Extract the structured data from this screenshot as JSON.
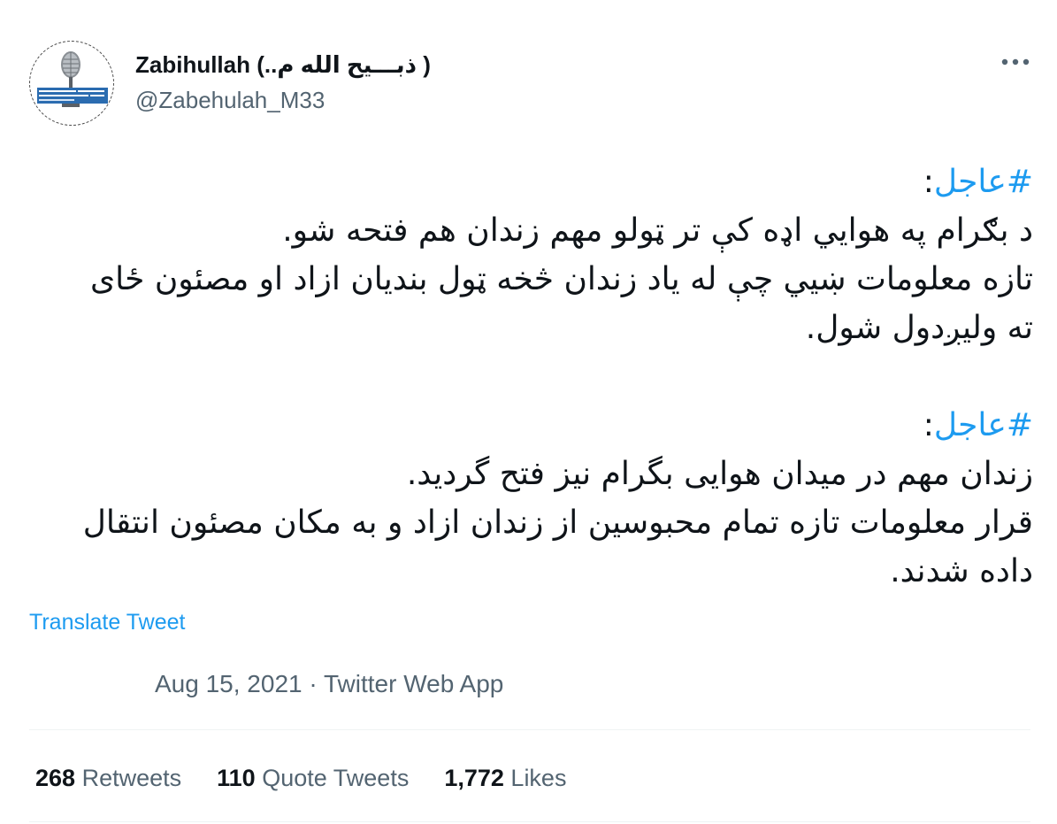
{
  "author": {
    "name": "Zabihullah (..ذبـــیح الله م )",
    "handle": "@Zabehulah_M33",
    "avatar_banner_lines": [
      "د افغانستان اسلامي امارت",
      "امارت اسلامی افغانستان"
    ]
  },
  "tweet": {
    "block1": {
      "hashtag": "#عاجل",
      "colon": ":",
      "lines": [
        "د بګرام په هوايي اډه کې تر ټولو مهم زندان هم فتحه شو.",
        "تازه معلومات ښيي چې له ياد زندان څخه ټول بنديان ازاد او مصئون ځای",
        "ته وليږدول شول."
      ]
    },
    "block2": {
      "hashtag": "#عاجل",
      "colon": ":",
      "lines": [
        "زندان مهم در میدان هوایی بگرام نیز فتح گردید.",
        "قرار معلومات تازه تمام محبوسین از زندان ازاد و به مکان مصئون انتقال",
        "داده شدند."
      ]
    }
  },
  "translate_label": "Translate Tweet",
  "meta": {
    "date": "Aug 15, 2021",
    "separator": " · ",
    "source": "Twitter Web App"
  },
  "stats": {
    "retweets": {
      "count": "268",
      "label": "Retweets"
    },
    "quote_tweets": {
      "count": "110",
      "label": "Quote Tweets"
    },
    "likes": {
      "count": "1,772",
      "label": "Likes"
    }
  },
  "colors": {
    "accent": "#1d9bf0",
    "text": "#0f1419",
    "secondary": "#536471",
    "divider": "#eff3f4"
  },
  "icons": {
    "avatar": "microphone-icon",
    "more": "more-options-icon"
  }
}
